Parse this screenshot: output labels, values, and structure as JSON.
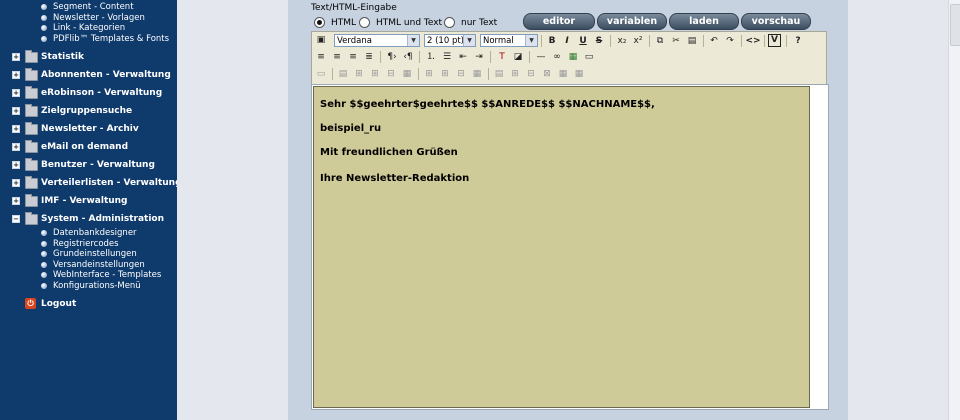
{
  "sidebar": {
    "top_subitems": [
      "Segment - Content",
      "Newsletter - Vorlagen",
      "Link - Kategorien",
      "PDFlib™ Templates & Fonts"
    ],
    "items": [
      {
        "label": "Statistik"
      },
      {
        "label": "Abonnenten - Verwaltung"
      },
      {
        "label": "eRobinson - Verwaltung"
      },
      {
        "label": "Zielgruppensuche"
      },
      {
        "label": "Newsletter - Archiv"
      },
      {
        "label": "eMail on demand"
      },
      {
        "label": "Benutzer - Verwaltung"
      },
      {
        "label": "Verteilerlisten - Verwaltung"
      },
      {
        "label": "IMF - Verwaltung"
      },
      {
        "label": "System - Administration"
      }
    ],
    "system_subitems": [
      "Datenbankdesigner",
      "Registriercodes",
      "Grundeinstellungen",
      "Versandeinstellungen",
      "WebInterface - Templates",
      "Konfigurations-Menü"
    ],
    "logout": "Logout"
  },
  "panel": {
    "title": "Text/HTML-Eingabe",
    "radios": [
      {
        "label": "HTML",
        "selected": true
      },
      {
        "label": "HTML und Text",
        "selected": false
      },
      {
        "label": "nur Text",
        "selected": false
      }
    ],
    "buttons": [
      "editor",
      "variablen",
      "laden",
      "vorschau"
    ]
  },
  "toolbar": {
    "font": "Verdana",
    "size": "2 (10 pt)",
    "format": "Normal",
    "bold": "B",
    "italic": "I",
    "underline": "U",
    "strike": "S",
    "source_label": "<>",
    "help_label": "?"
  },
  "editor": {
    "lines": [
      "Sehr $$geehrter$geehrte$$ $$ANREDE$$ $$NACHNAME$$,",
      "beispiel_ru",
      "Mit freundlichen Grüßen",
      "Ihre Newsletter-Redaktion"
    ]
  }
}
